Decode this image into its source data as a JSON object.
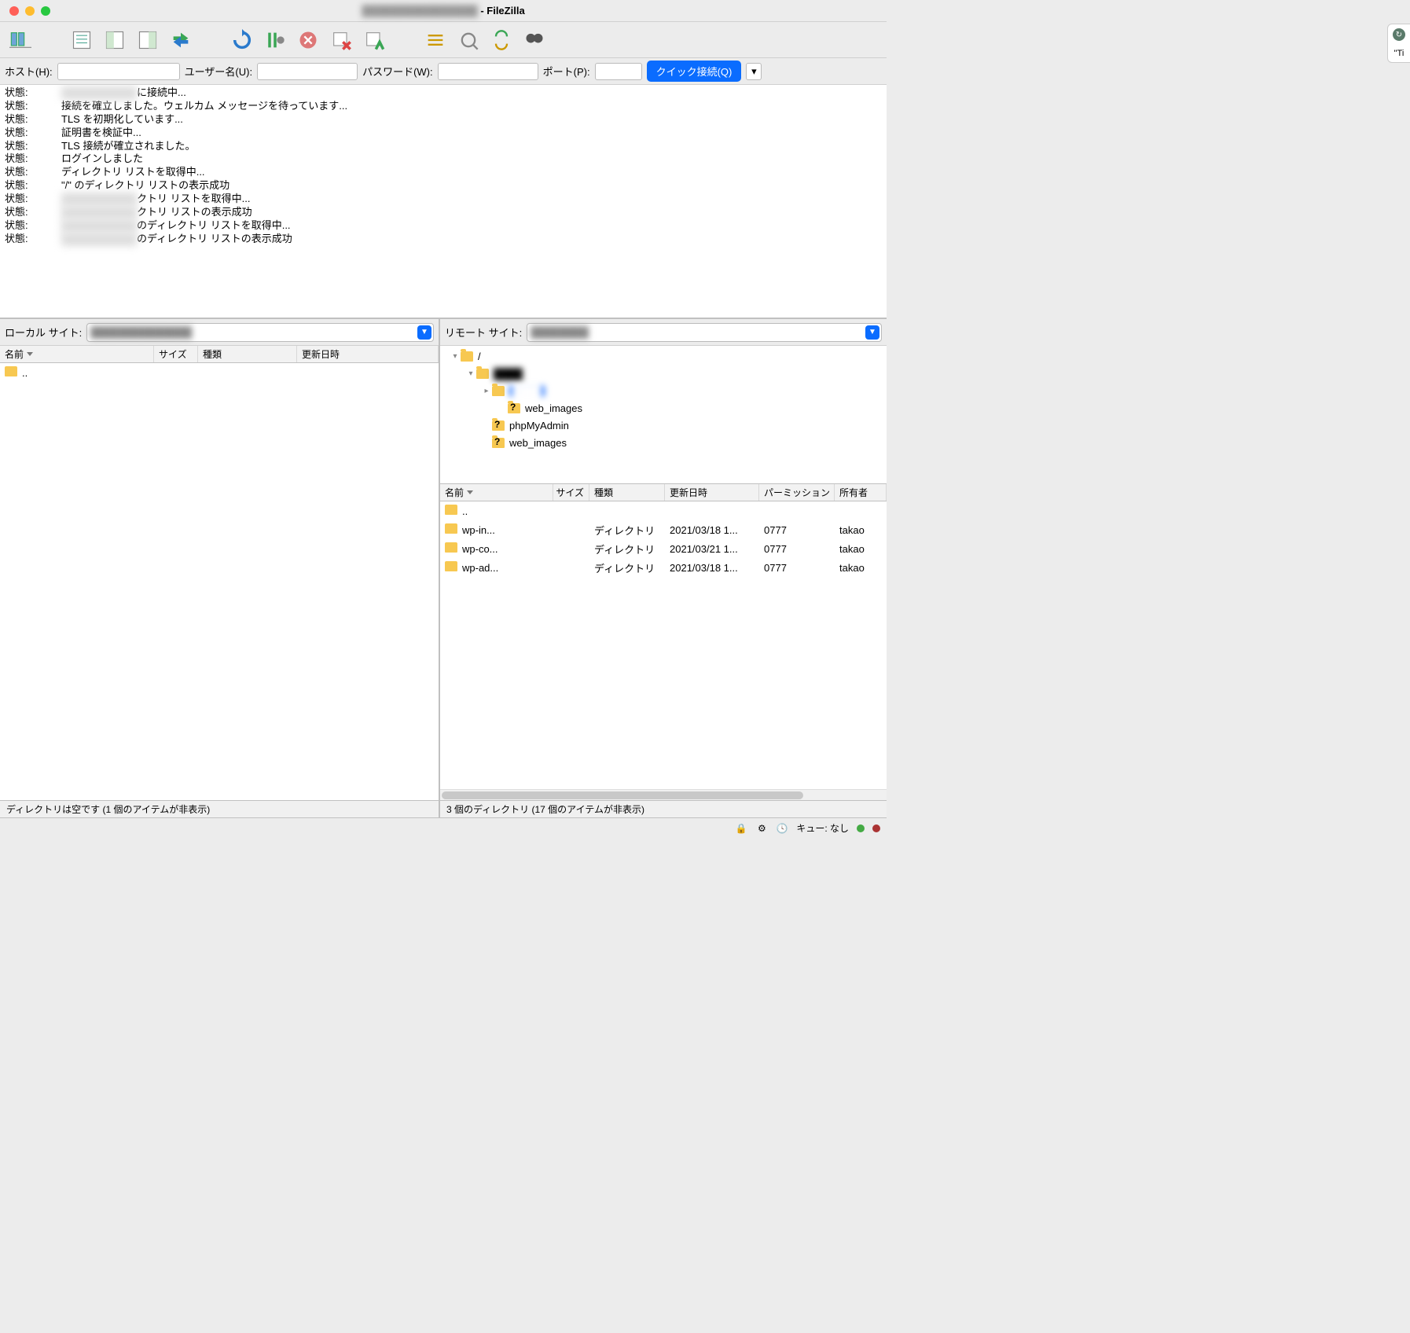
{
  "title_suffix": "- FileZilla",
  "notif_hint": "\"Ti",
  "quickconnect": {
    "host_label": "ホスト(H):",
    "user_label": "ユーザー名(U):",
    "pass_label": "パスワード(W):",
    "port_label": "ポート(P):",
    "connect_label": "クイック接続(Q)"
  },
  "log_label": "状態:",
  "log": [
    {
      "blur": true,
      "suffix": "に接続中..."
    },
    {
      "text": "接続を確立しました。ウェルカム メッセージを待っています..."
    },
    {
      "text": "TLS を初期化しています..."
    },
    {
      "text": "証明書を検証中..."
    },
    {
      "text": "TLS 接続が確立されました。"
    },
    {
      "text": "ログインしました"
    },
    {
      "text": "ディレクトリ リストを取得中..."
    },
    {
      "text": "\"/\" のディレクトリ リストの表示成功"
    },
    {
      "blur": true,
      "suffix": "クトリ リストを取得中..."
    },
    {
      "blur": true,
      "suffix": "クトリ リストの表示成功"
    },
    {
      "blur": true,
      "suffix": "のディレクトリ リストを取得中..."
    },
    {
      "blur": true,
      "suffix": "のディレクトリ リストの表示成功"
    }
  ],
  "local": {
    "site_label": "ローカル サイト:",
    "headers": {
      "name": "名前",
      "size": "サイズ",
      "type": "種類",
      "modified": "更新日時"
    },
    "rows": [
      {
        "name": ".."
      }
    ],
    "status": "ディレクトリは空です (1 個のアイテムが非表示)"
  },
  "remote": {
    "site_label": "リモート サイト:",
    "tree": [
      {
        "indent": 0,
        "arrow": "▾",
        "name": "/",
        "icon": "folder"
      },
      {
        "indent": 1,
        "arrow": "▾",
        "name": "████",
        "icon": "folder",
        "blur": true
      },
      {
        "indent": 2,
        "arrow": "▸",
        "name": "████",
        "icon": "folder",
        "selected": true,
        "blur": true
      },
      {
        "indent": 3,
        "arrow": "",
        "name": "web_images",
        "icon": "folder-q"
      },
      {
        "indent": 2,
        "arrow": "",
        "name": "phpMyAdmin",
        "icon": "folder-q"
      },
      {
        "indent": 2,
        "arrow": "",
        "name": "web_images",
        "icon": "folder-q"
      }
    ],
    "headers": {
      "name": "名前",
      "size": "サイズ",
      "type": "種類",
      "modified": "更新日時",
      "perm": "パーミッション",
      "owner": "所有者"
    },
    "rows": [
      {
        "name": "..",
        "size": "",
        "type": "",
        "modified": "",
        "perm": "",
        "owner": ""
      },
      {
        "name": "wp-in...",
        "size": "",
        "type": "ディレクトリ",
        "modified": "2021/03/18 1...",
        "perm": "0777",
        "owner": "takao"
      },
      {
        "name": "wp-co...",
        "size": "",
        "type": "ディレクトリ",
        "modified": "2021/03/21 1...",
        "perm": "0777",
        "owner": "takao"
      },
      {
        "name": "wp-ad...",
        "size": "",
        "type": "ディレクトリ",
        "modified": "2021/03/18 1...",
        "perm": "0777",
        "owner": "takao"
      }
    ],
    "status": "3 個のディレクトリ (17 個のアイテムが非表示)"
  },
  "bottom": {
    "queue_label": "キュー: なし"
  }
}
